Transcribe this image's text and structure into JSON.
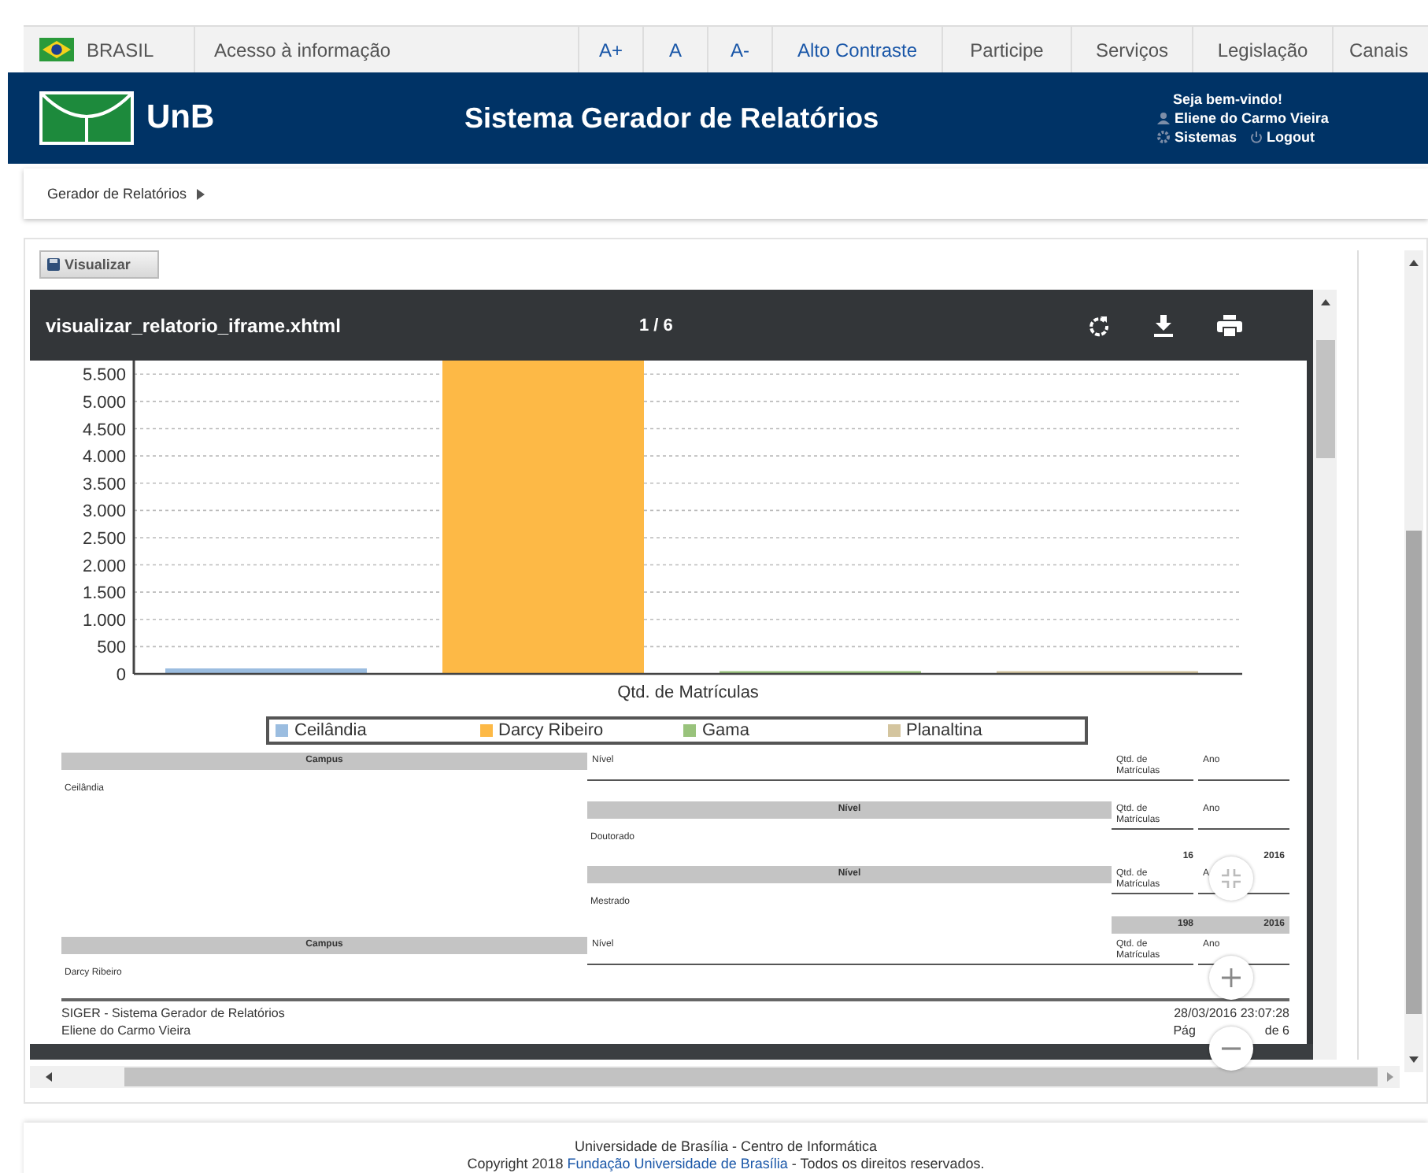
{
  "gov_bar": {
    "country": "BRASIL",
    "links": [
      {
        "label": "Acesso à informação",
        "kind": "link"
      },
      {
        "label": "A+",
        "kind": "accessibility"
      },
      {
        "label": "A",
        "kind": "accessibility"
      },
      {
        "label": "A-",
        "kind": "accessibility"
      },
      {
        "label": "Alto Contraste",
        "kind": "accessibility"
      },
      {
        "label": "Participe",
        "kind": "link"
      },
      {
        "label": "Serviços",
        "kind": "link"
      },
      {
        "label": "Legislação",
        "kind": "link"
      },
      {
        "label": "Canais",
        "kind": "link"
      }
    ]
  },
  "header": {
    "logo": "UnB",
    "title": "Sistema Gerador de Relatórios",
    "welcome": "Seja bem-vindo!",
    "user": "Eliene do Carmo Vieira",
    "systems": "Sistemas",
    "logout": "Logout"
  },
  "breadcrumb": [
    "Gerador de Relatórios"
  ],
  "toolbar": {
    "button": "Visualizar"
  },
  "viewer": {
    "title": "visualizar_relatorio_iframe.xhtml",
    "page": "1 / 6",
    "chart_data": {
      "type": "bar",
      "grid": true,
      "categories": [
        "Qtd. de Matrículas"
      ],
      "series": [
        {
          "name": "Ceilândia",
          "color": "#9bbde0",
          "values": [
            100
          ]
        },
        {
          "name": "Darcy Ribeiro",
          "color": "#fdb946",
          "values": [
            5750
          ]
        },
        {
          "name": "Gama",
          "color": "#99c37c",
          "values": [
            50
          ]
        },
        {
          "name": "Planaltina",
          "color": "#d4c59f",
          "values": [
            50
          ]
        }
      ],
      "ylim": [
        0,
        5750
      ],
      "yticks": [
        {
          "value": 0,
          "label": "0"
        },
        {
          "value": 500,
          "label": "500"
        },
        {
          "value": 1000,
          "label": "1.000"
        },
        {
          "value": 1500,
          "label": "1.500"
        },
        {
          "value": 2000,
          "label": "2.000"
        },
        {
          "value": 2500,
          "label": "2.500"
        },
        {
          "value": 3000,
          "label": "3.000"
        },
        {
          "value": 3500,
          "label": "3.500"
        },
        {
          "value": 4000,
          "label": "4.000"
        },
        {
          "value": 4500,
          "label": "4.500"
        },
        {
          "value": 5000,
          "label": "5.000"
        },
        {
          "value": 5500,
          "label": "5.500"
        }
      ]
    },
    "rows": [
      {
        "kind": "campus_header",
        "campus": "Campus",
        "nivel": "Nível",
        "qtd": "Qtd. de Matrículas",
        "ano": "Ano"
      },
      {
        "kind": "campus_value",
        "text": "Ceilândia"
      },
      {
        "kind": "level_header",
        "nivel": "Nível",
        "qtd": "Qtd. de Matrículas",
        "ano": "Ano"
      },
      {
        "kind": "level_value",
        "text": "Doutorado"
      },
      {
        "kind": "values",
        "qtd": "16",
        "ano": "2016"
      },
      {
        "kind": "level_header",
        "nivel": "Nível",
        "qtd": "Qtd. de Matrículas",
        "ano": "A"
      },
      {
        "kind": "level_value",
        "text": "Mestrado"
      },
      {
        "kind": "total",
        "qtd": "198",
        "ano": "2016"
      },
      {
        "kind": "campus_header",
        "campus": "Campus",
        "nivel": "Nível",
        "qtd": "Qtd. de Matrículas",
        "ano": "Ano"
      },
      {
        "kind": "campus_value",
        "text": "Darcy Ribeiro"
      }
    ],
    "footer": {
      "system": "SIGER - Sistema Gerador de Relatórios",
      "timestamp": "28/03/2016 23:07:28",
      "user": "Eliene do Carmo Vieira",
      "page_start": "Pág",
      "page_end": "de 6"
    }
  },
  "footer": {
    "line1": "Universidade de Brasília - Centro de Informática",
    "before": "Copyright 2018 ",
    "link": "Fundação Universidade de Brasília",
    "after": " - Todos os direitos reservados."
  }
}
